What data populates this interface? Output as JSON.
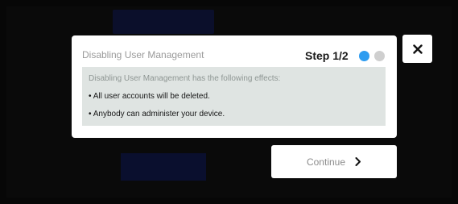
{
  "dialog": {
    "title": "Disabling User Management",
    "step_label": "Step 1/2",
    "step_dots": [
      "active",
      "inactive"
    ],
    "info": {
      "heading": "Disabling User Management has the following effects:",
      "items": [
        "• All user accounts will be deleted.",
        "• Anybody can administer your device."
      ]
    }
  },
  "continue_button": {
    "label": "Continue",
    "icon": "chevron-right-icon"
  },
  "close_button": {
    "icon": "close-icon"
  },
  "colors": {
    "accent": "#2d9cf0",
    "inactive_dot": "#cfcfcf",
    "info_background": "#dfe4e2",
    "background": "#070707"
  }
}
